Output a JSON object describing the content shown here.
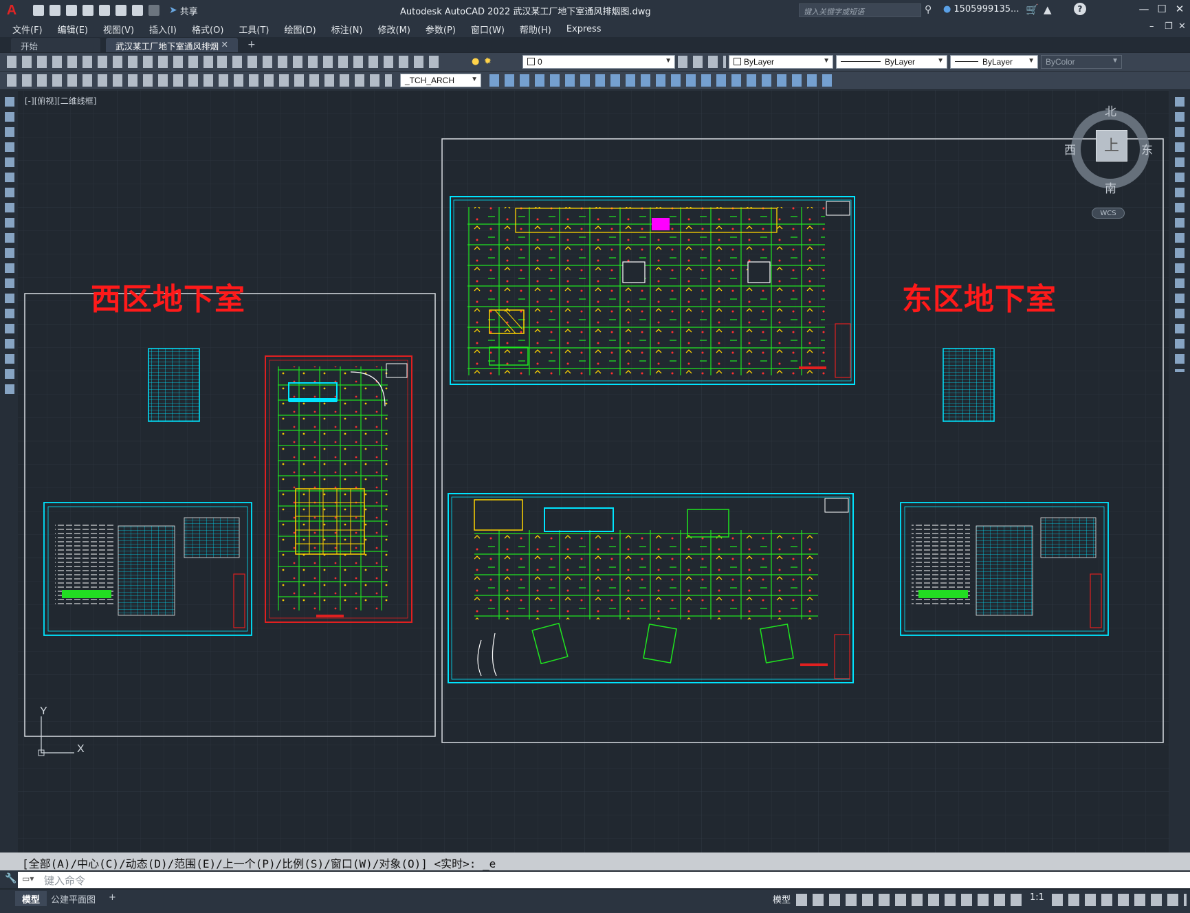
{
  "titlebar": {
    "app_title": "Autodesk AutoCAD 2022    武汉某工厂地下室通风排烟图.dwg",
    "share_label": "共享",
    "search_placeholder": "键入关键字或短语",
    "user_name": "1505999135...",
    "help_label": "?",
    "minimize": "—",
    "restore": "☐",
    "close": "✕"
  },
  "menu": {
    "items": [
      "文件(F)",
      "编辑(E)",
      "视图(V)",
      "插入(I)",
      "格式(O)",
      "工具(T)",
      "绘图(D)",
      "标注(N)",
      "修改(M)",
      "参数(P)",
      "窗口(W)",
      "帮助(H)",
      "Express"
    ]
  },
  "tabs": {
    "start": "开始",
    "active": "武汉某工厂地下室通风排烟图*",
    "close": "✕",
    "add": "+"
  },
  "toolbar": {
    "layer_value": "0",
    "color_value": "ByLayer",
    "linetype_value": "ByLayer",
    "lineweight_value": "ByLayer",
    "plotstyle_value": "ByColor",
    "textstyle_value": "_TCH_ARCH"
  },
  "viewport": {
    "label": "[-][俯视][二维线框]",
    "west_zone": "西区地下室",
    "east_zone": "东区地下室"
  },
  "viewcube": {
    "north": "北",
    "south": "南",
    "east": "东",
    "west": "西",
    "face": "上",
    "wcs": "WCS"
  },
  "ucs": {
    "x": "X",
    "y": "Y"
  },
  "command": {
    "history": "[全部(A)/中心(C)/动态(D)/范围(E)/上一个(P)/比例(S)/窗口(W)/对象(O)] <实时>: _e",
    "placeholder": "键入命令"
  },
  "statusbar": {
    "tabs": [
      "模型",
      "公建平面图"
    ],
    "add": "+",
    "model": "模型",
    "scale": "1:1"
  },
  "colors": {
    "canvas_bg": "#212830",
    "zone_label": "#ff1a1a",
    "frame_cyan": "#00e5ff",
    "duct_green": "#22ff22",
    "boundary_red": "#e02020"
  }
}
